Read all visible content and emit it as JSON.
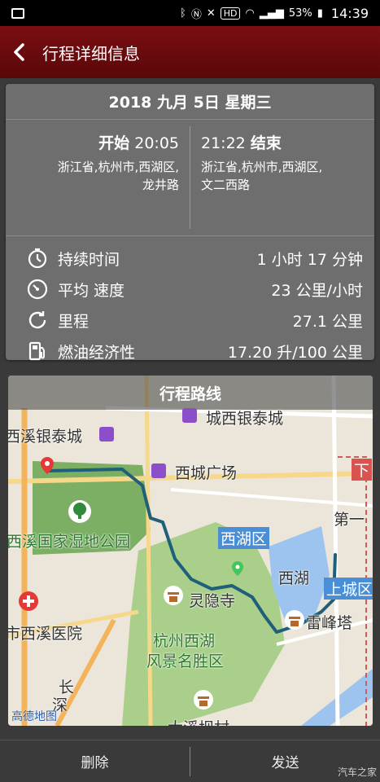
{
  "status_bar": {
    "battery": "53%",
    "time": "14:39",
    "hd_badge": "HD"
  },
  "header": {
    "title": "行程详细信息"
  },
  "trip": {
    "date": "2018 九月 5日 星期三",
    "start": {
      "label": "开始",
      "time": "20:05",
      "address_line1": "浙江省,杭州市,西湖区,",
      "address_line2": "龙井路"
    },
    "end": {
      "label": "结束",
      "time": "21:22",
      "address_line1": "浙江省,杭州市,西湖区,",
      "address_line2": "文二西路"
    },
    "stats": [
      {
        "icon": "stopwatch-icon",
        "label": "持续时间",
        "value": "1 小时 17 分钟"
      },
      {
        "icon": "speedometer-icon",
        "label": "平均 速度",
        "value": "23 公里/小时"
      },
      {
        "icon": "refresh-icon",
        "label": "里程",
        "value": "27.1 公里"
      },
      {
        "icon": "fuel-pump-icon",
        "label": "燃油经济性",
        "value": "17.20 升/100 公里"
      }
    ]
  },
  "map": {
    "title": "行程路线",
    "labels": {
      "l1": "城西银泰城",
      "l2": "西溪银泰城",
      "l3": "西城广场",
      "l4": "西溪国家湿地公园",
      "l5": "西湖区",
      "l6": "西湖",
      "l7": "灵隐寺",
      "l8": "上城区",
      "l9": "雷峰塔",
      "l10": "杭州西湖",
      "l11": "风景名胜区",
      "l12": "市西溪医院",
      "l13": "第一",
      "l14": "下",
      "l15": "长",
      "l16": "深",
      "l17": "大溪坝村"
    },
    "brand": "高德地图",
    "colors": {
      "route": "#1f5f7a",
      "water": "#9cc4ee",
      "park": "#a9cf8a"
    }
  },
  "bottom": {
    "delete_label": "删除",
    "send_label": "发送",
    "watermark": "汽车之家"
  }
}
